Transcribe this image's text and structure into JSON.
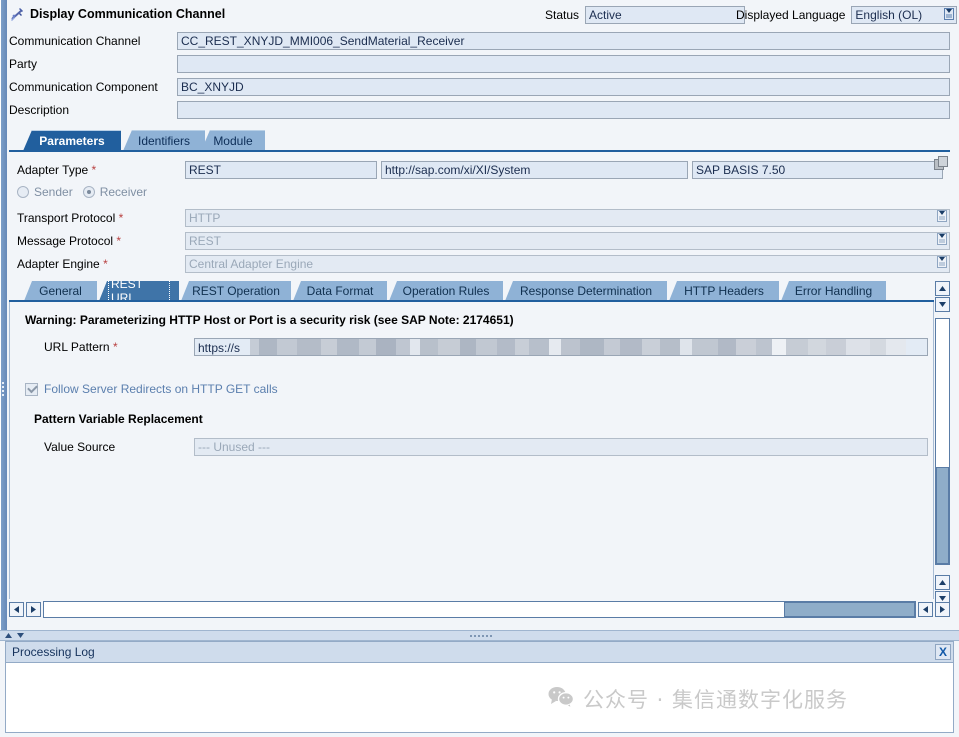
{
  "window": {
    "title": "Display Communication Channel",
    "title_icon": "plug-connector-icon"
  },
  "header": {
    "status_label": "Status",
    "status_value": "Active",
    "language_label": "Displayed Language",
    "language_value": "English (OL)",
    "language_value_help_icon": "value-help-icon",
    "fields": [
      {
        "label": "Communication Channel",
        "value": "CC_REST_XNYJD_MMI006_SendMaterial_Receiver"
      },
      {
        "label": "Party",
        "value": ""
      },
      {
        "label": "Communication Component",
        "value": "BC_XNYJD"
      },
      {
        "label": "Description",
        "value": ""
      }
    ]
  },
  "outer_tabs": [
    {
      "label": "Parameters",
      "selected": true
    },
    {
      "label": "Identifiers",
      "selected": false
    },
    {
      "label": "Module",
      "selected": false
    }
  ],
  "parameters": {
    "adapter_type": {
      "label": "Adapter Type",
      "required": "*",
      "value": "REST",
      "namespace": "http://sap.com/xi/XI/System",
      "software_component": "SAP BASIS 7.50",
      "copy_icon": "copy-icon"
    },
    "direction": {
      "sender_label": "Sender",
      "receiver_label": "Receiver",
      "selected": "Receiver"
    },
    "rows": [
      {
        "label": "Transport Protocol",
        "required": "*",
        "value": "HTTP",
        "icon": "value-help-icon"
      },
      {
        "label": "Message Protocol",
        "required": "*",
        "value": "REST",
        "icon": "value-help-icon"
      },
      {
        "label": "Adapter Engine",
        "required": "*",
        "value": "Central Adapter Engine",
        "icon": "value-help-icon"
      }
    ]
  },
  "inner_tabs": [
    {
      "label": "General",
      "selected": false
    },
    {
      "label": "REST URL",
      "selected": true
    },
    {
      "label": "REST Operation",
      "selected": false
    },
    {
      "label": "Data Format",
      "selected": false
    },
    {
      "label": "Operation Rules",
      "selected": false
    },
    {
      "label": "Response Determination",
      "selected": false
    },
    {
      "label": "HTTP Headers",
      "selected": false
    },
    {
      "label": "Error Handling",
      "selected": false
    }
  ],
  "rest_url": {
    "warning": "Warning: Parameterizing HTTP Host or Port is a security risk (see SAP Note: 2174651)",
    "url_pattern_label": "URL Pattern",
    "url_pattern_required": "*",
    "url_pattern_visible_value": "https://s",
    "url_pattern_redacted": true,
    "follow_redirects_label": "Follow Server Redirects on HTTP GET calls",
    "follow_redirects_checked": true,
    "group_header": "Pattern Variable Replacement",
    "value_source_label": "Value Source",
    "value_source_value": "--- Unused ---"
  },
  "processing_log": {
    "title": "Processing Log",
    "close_label": "X",
    "close_icon": "close-icon"
  },
  "watermark": {
    "text": "公众号 · 集信通数字化服务",
    "icon": "wechat-icon"
  },
  "colors": {
    "accent_blue": "#215f9e",
    "tab_blue": "#8fb2d6",
    "field_blue": "#dfe8f4",
    "panel_bg": "#f2f5f9",
    "required_red": "#b84040",
    "disabled_text": "#9aa8b8"
  }
}
